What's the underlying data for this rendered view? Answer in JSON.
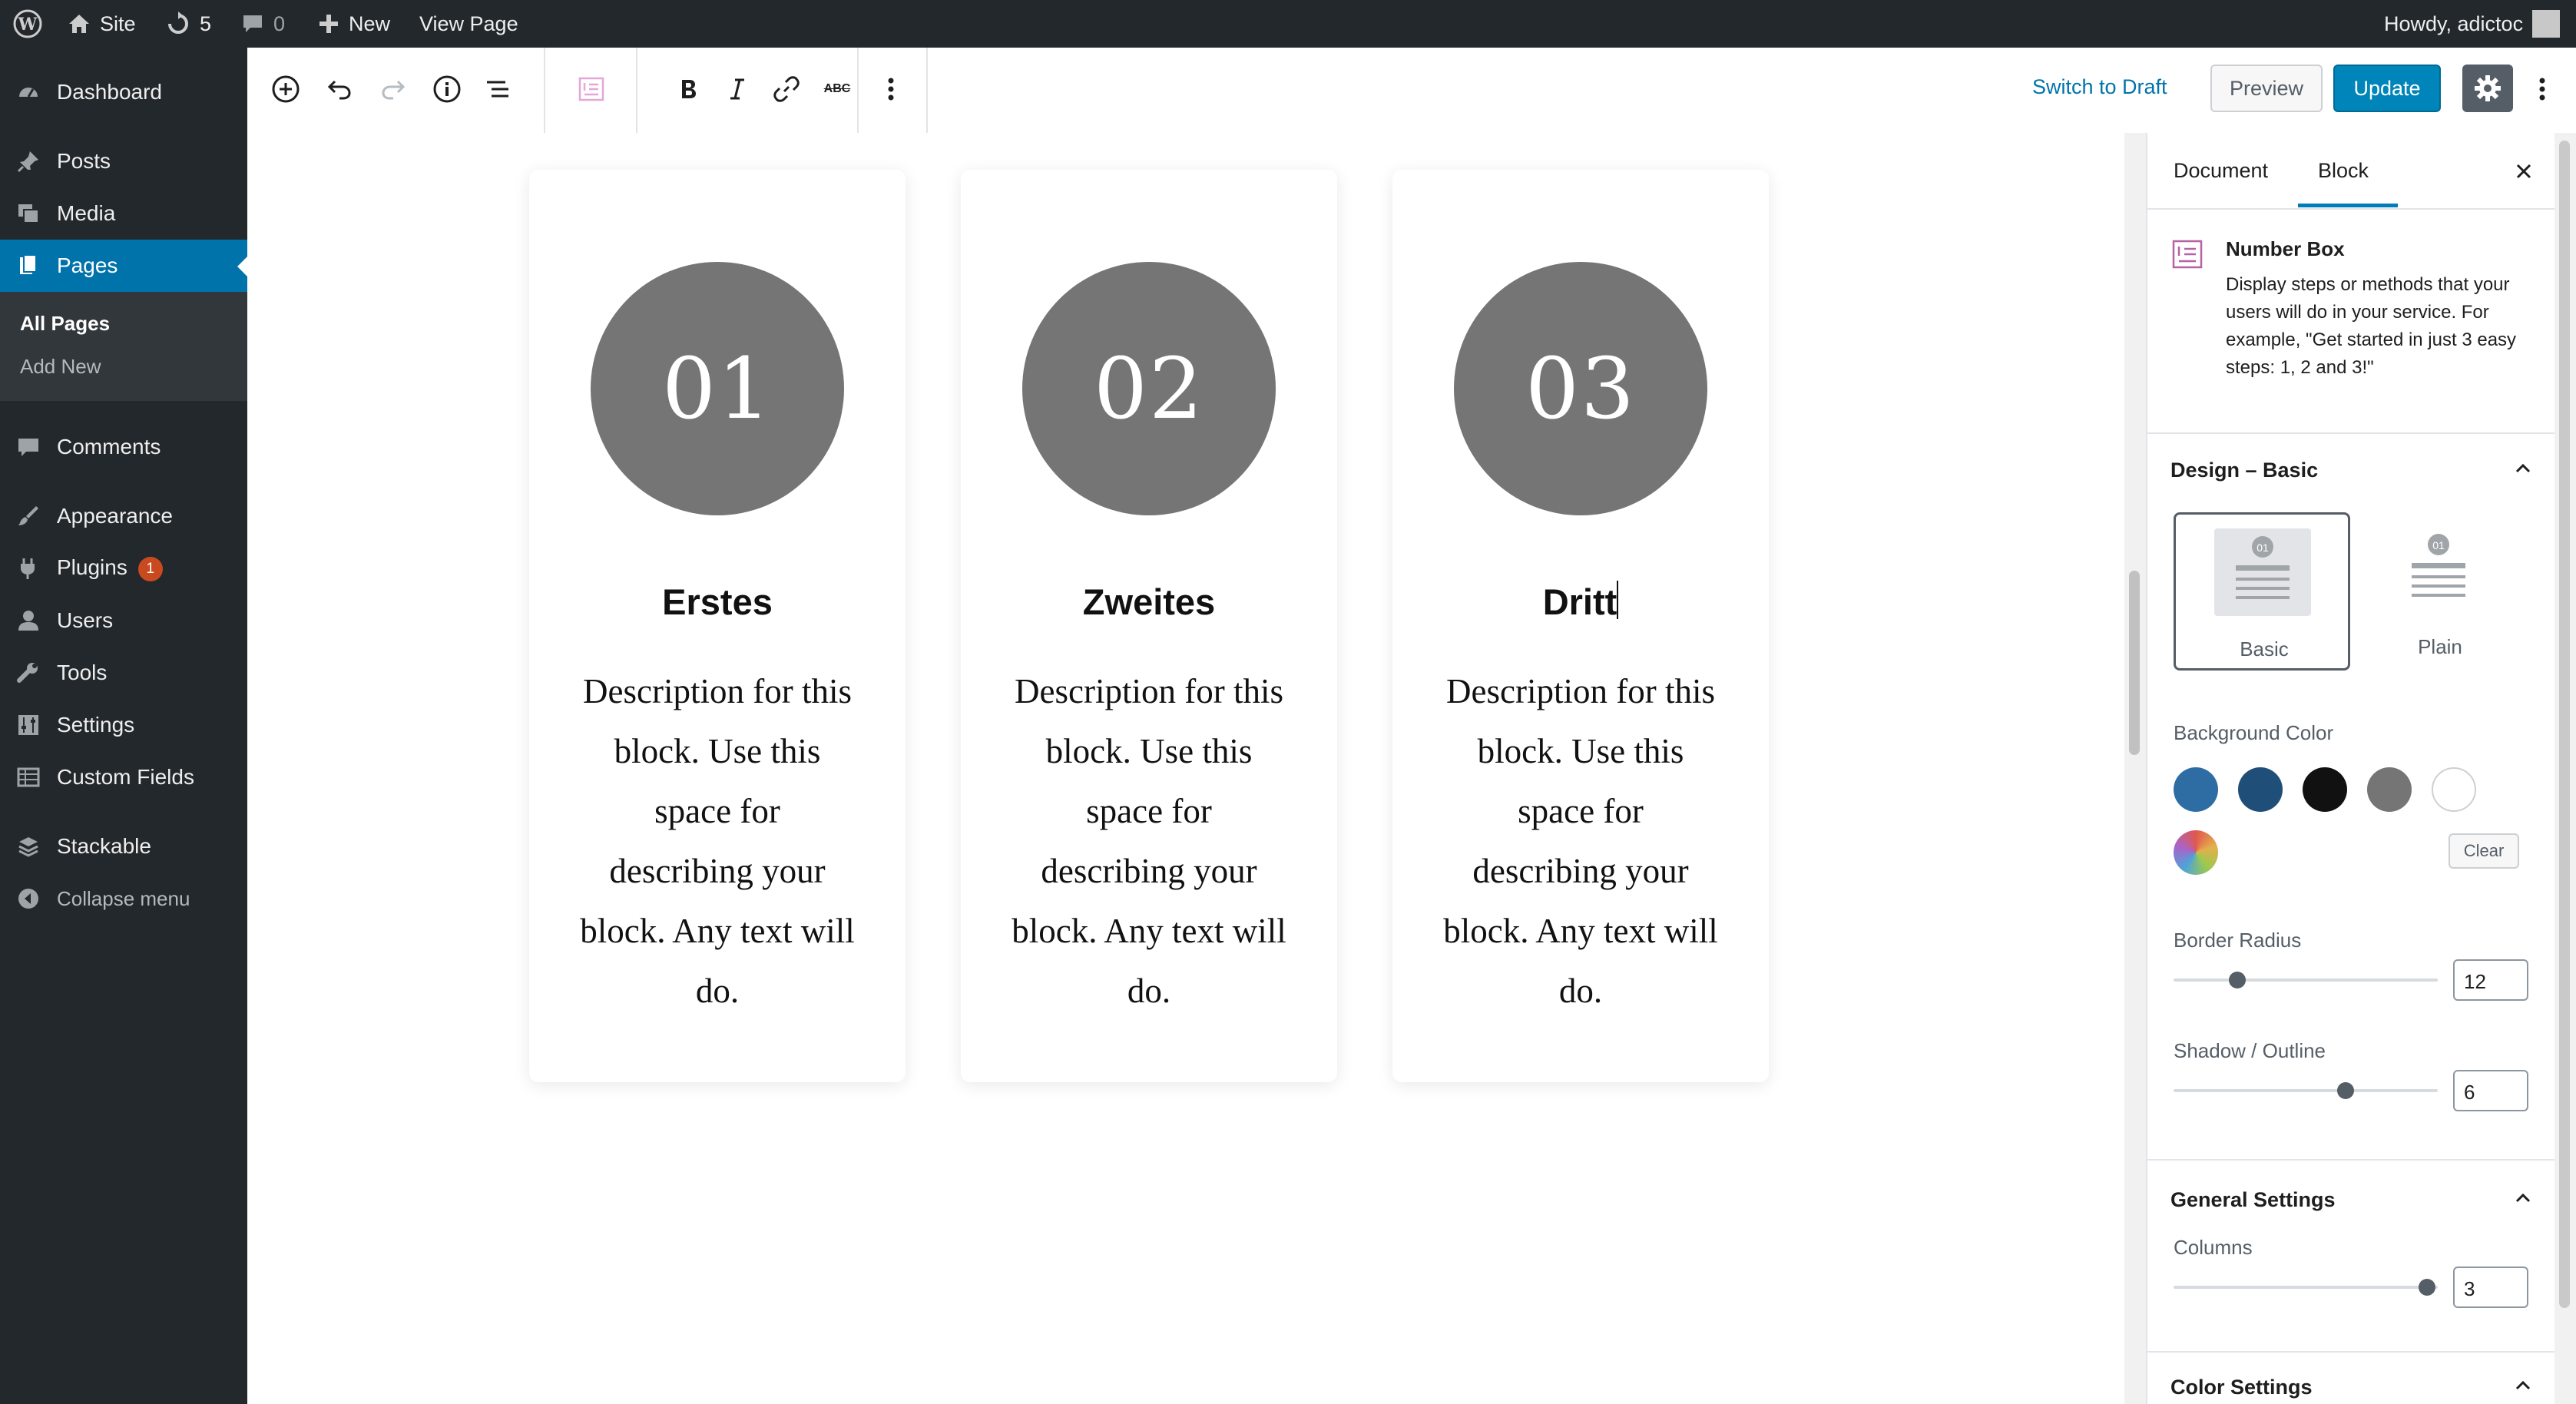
{
  "admin_bar": {
    "site_label": "Site",
    "updates_count": "5",
    "comments_count": "0",
    "new_label": "New",
    "view_page_label": "View Page",
    "howdy_label": "Howdy, adictoc"
  },
  "admin_menu": {
    "dashboard": "Dashboard",
    "posts": "Posts",
    "media": "Media",
    "pages": "Pages",
    "submenu_all_pages": "All Pages",
    "submenu_add_new": "Add New",
    "comments": "Comments",
    "appearance": "Appearance",
    "plugins": "Plugins",
    "plugins_badge": "1",
    "users": "Users",
    "tools": "Tools",
    "settings": "Settings",
    "custom_fields": "Custom Fields",
    "stackable": "Stackable",
    "collapse": "Collapse menu"
  },
  "editor_header": {
    "switch_to_draft": "Switch to Draft",
    "preview": "Preview",
    "update": "Update",
    "strikethrough_label": "ABC"
  },
  "cards": [
    {
      "number": "01",
      "title": "Erstes",
      "description": "Description for this block. Use this space for describing your block. Any text will do."
    },
    {
      "number": "02",
      "title": "Zweites",
      "description": "Description for this block. Use this space for describing your block. Any text will do."
    },
    {
      "number": "03",
      "title": "Dritt",
      "description": "Description for this block. Use this space for describing your block. Any text will do."
    }
  ],
  "sidebar": {
    "tab_document": "Document",
    "tab_block": "Block",
    "block_name": "Number Box",
    "block_description": "Display steps or methods that your users will do in your service. For example, \"Get started in just 3 easy steps: 1, 2 and 3!\"",
    "design_title": "Design – Basic",
    "style_basic": "Basic",
    "style_plain": "Plain",
    "style_preview_number": "01",
    "background_color_label": "Background Color",
    "clear_label": "Clear",
    "border_radius_label": "Border Radius",
    "border_radius_value": "12",
    "shadow_label": "Shadow / Outline",
    "shadow_value": "6",
    "general_settings_title": "General Settings",
    "columns_label": "Columns",
    "columns_value": "3",
    "color_settings_title": "Color Settings",
    "swatches": [
      "#2e6da4",
      "#1f4e79",
      "#111111",
      "#757575",
      "#ffffff"
    ],
    "accent": "#007cba",
    "border_radius_fraction": 0.24,
    "shadow_fraction": 0.65,
    "columns_fraction": 0.96
  }
}
